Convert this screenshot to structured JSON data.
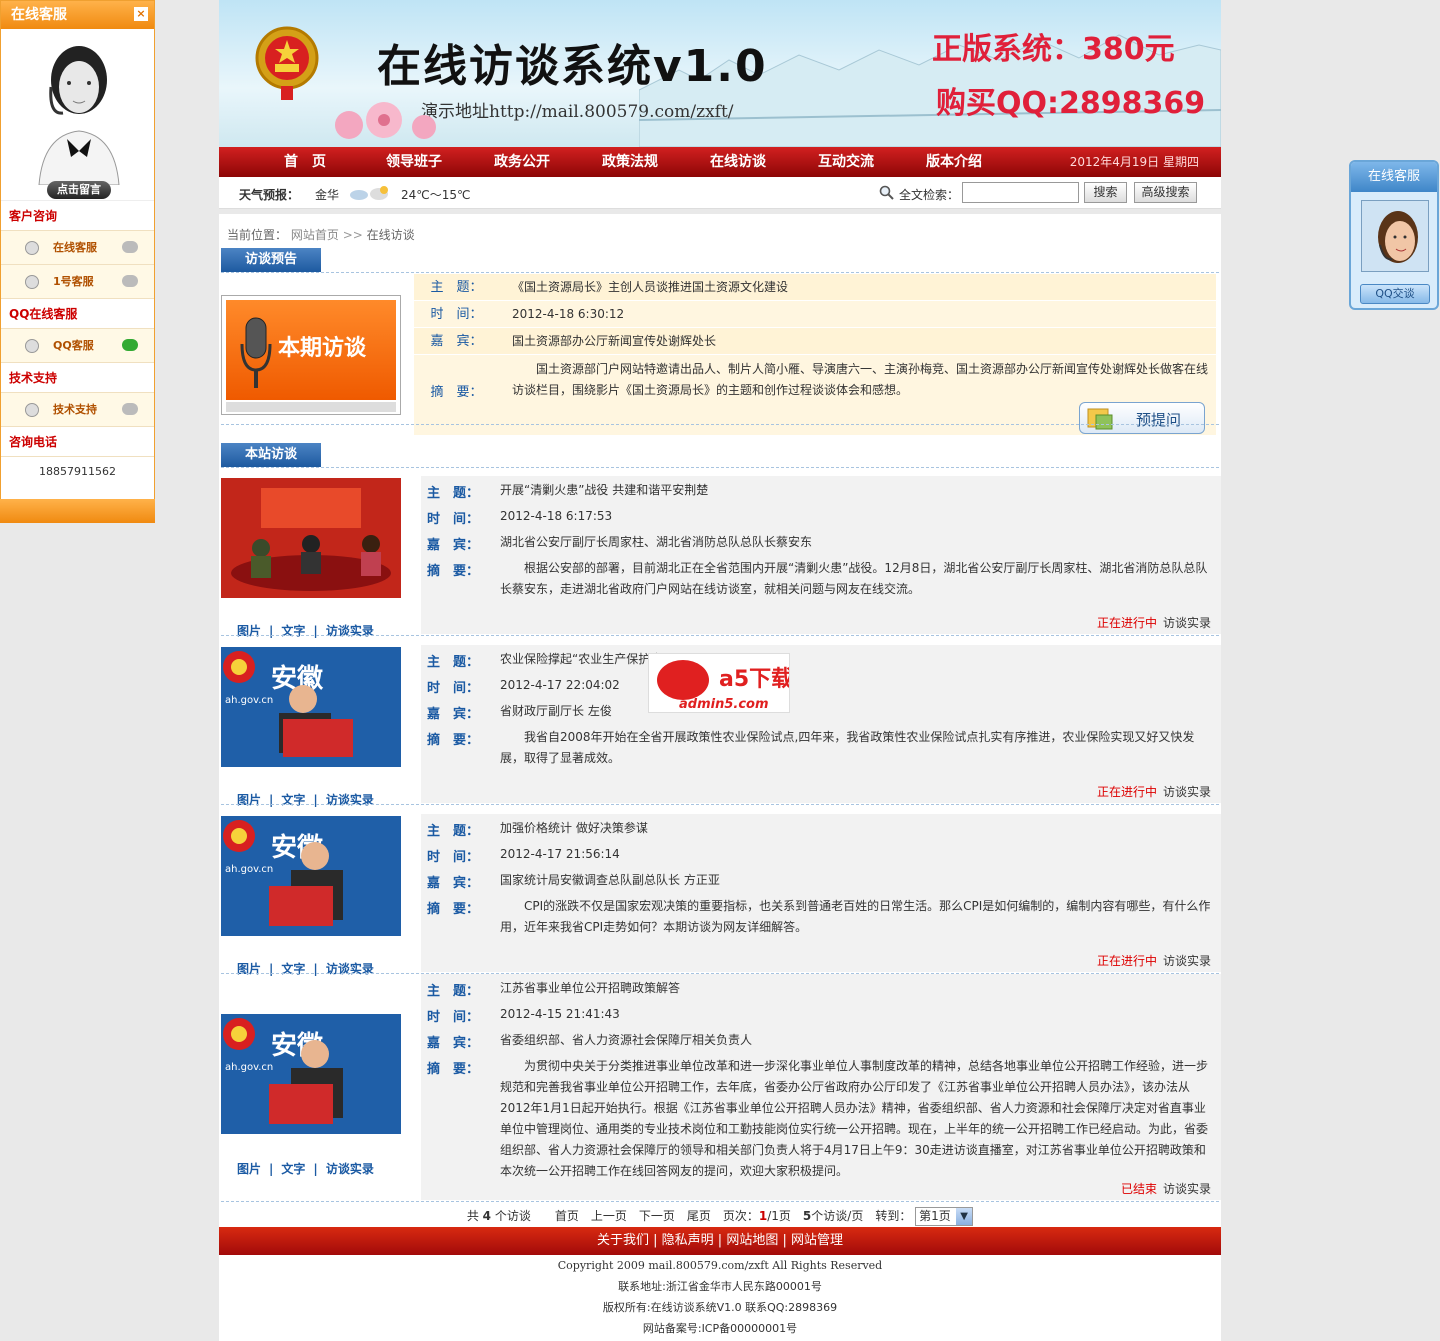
{
  "left_cs": {
    "title": "在线客服",
    "close": "×",
    "leave_msg": "点击留言",
    "sections": [
      {
        "title": "客户咨询",
        "items": [
          "在线客服",
          "1号客服"
        ]
      },
      {
        "title": "QQ在线客服",
        "items": [
          "QQ客服"
        ]
      },
      {
        "title": "技术支持",
        "items": [
          "技术支持"
        ]
      },
      {
        "title": "咨询电话",
        "items": []
      }
    ],
    "phone": "18857911562"
  },
  "right_cs": {
    "title": "在线客服",
    "button": "QQ交谈"
  },
  "banner": {
    "title": "在线访谈系统v1.0",
    "demo": "演示地址http://mail.800579.com/zxft/",
    "price": "正版系统：380元",
    "qq": "购买QQ:2898369"
  },
  "nav": {
    "items": [
      "首　页",
      "领导班子",
      "政务公开",
      "政策法规",
      "在线访谈",
      "互动交流",
      "版本介绍"
    ],
    "date": "2012年4月19日 星期四"
  },
  "toolbar": {
    "weather_label": "天气预报：",
    "city": "金华",
    "temp": "24℃～15℃",
    "search_label": "全文检索：",
    "search_btn": "搜索",
    "adv_btn": "高级搜索"
  },
  "crumb": {
    "label": "当前位置：",
    "home": "网站首页",
    "sep": ">>",
    "current": "在线访谈"
  },
  "preview": {
    "tab": "访谈预告",
    "image_text": "本期访谈",
    "labels": {
      "subject": "主　题：",
      "time": "时　间：",
      "guest": "嘉　宾：",
      "summary": "摘　要："
    },
    "subject": "《国土资源局长》主创人员谈推进国土资源文化建设",
    "time": "2012-4-18 6:30:12",
    "guest": "国土资源部办公厅新闻宣传处谢辉处长",
    "summary": "国土资源部门户网站特邀请出品人、制片人简小雁、导演唐六一、主演孙梅竞、国土资源部办公厅新闻宣传处谢辉处长做客在线访谈栏目，围绕影片《国土资源局长》的主题和创作过程谈谈体会和感想。",
    "ask_btn": "预提问"
  },
  "list": {
    "tab": "本站访谈",
    "links": [
      "图片",
      "|",
      "文字",
      "|",
      "访谈实录"
    ],
    "labels": {
      "subject": "主　题：",
      "time": "时　间：",
      "guest": "嘉　宾：",
      "summary": "摘　要："
    },
    "record": "访谈实录",
    "items": [
      {
        "subject": "开展“清剿火患”战役 共建和谐平安荆楚",
        "time": "2012-4-18 6:17:53",
        "guest": "湖北省公安厅副厅长周家柱、湖北省消防总队总队长蔡安东",
        "summary": "根据公安部的部署，目前湖北正在全省范围内开展“清剿火患”战役。12月8日，湖北省公安厅副厅长周家柱、湖北省消防总队总队长蔡安东，走进湖北省政府门户网站在线访谈室，就相关问题与网友在线交流。",
        "status": "正在进行中"
      },
      {
        "subject": "农业保险撑起“农业生产保护伞”",
        "time": "2012-4-17 22:04:02",
        "guest": "省财政厅副厅长 左俊",
        "summary": "我省自2008年开始在全省开展政策性农业保险试点,四年来，我省政策性农业保险试点扎实有序推进，农业保险实现又好又快发展，取得了显著成效。",
        "status": "正在进行中"
      },
      {
        "subject": "加强价格统计 做好决策参谋",
        "time": "2012-4-17 21:56:14",
        "guest": "国家统计局安徽调查总队副总队长 方正亚",
        "summary": "CPI的涨跌不仅是国家宏观决策的重要指标，也关系到普通老百姓的日常生活。那么CPI是如何编制的，编制内容有哪些，有什么作用，近年来我省CPI走势如何？本期访谈为网友详细解答。",
        "status": "正在进行中"
      },
      {
        "subject": "江苏省事业单位公开招聘政策解答",
        "time": "2012-4-15 21:41:43",
        "guest": "省委组织部、省人力资源社会保障厅相关负责人",
        "summary": "为贯彻中央关于分类推进事业单位改革和进一步深化事业单位人事制度改革的精神，总结各地事业单位公开招聘工作经验，进一步规范和完善我省事业单位公开招聘工作，去年底，省委办公厅省政府办公厅印发了《江苏省事业单位公开招聘人员办法》，该办法从2012年1月1日起开始执行。根据《江苏省事业单位公开招聘人员办法》精神，省委组织部、省人力资源和社会保障厅决定对省直事业单位中管理岗位、通用类的专业技术岗位和工勤技能岗位实行统一公开招聘。现在，上半年的统一公开招聘工作已经启动。为此，省委组织部、省人力资源社会保障厅的领导和相关部门负责人将于4月17日上午9：30走进访谈直播室，对江苏省事业单位公开招聘政策和本次统一公开招聘工作在线回答网友的提问，欢迎大家积极提问。",
        "status": "已结束"
      }
    ]
  },
  "watermark": {
    "brand": "a5下载",
    "site": "admin5.com"
  },
  "thumb_text": {
    "ah_site": "ah.gov.cn",
    "anhui": "安徽"
  },
  "pager": {
    "text1": "共",
    "total": "4",
    "text2": "个访谈　　首页　上一页　下一页　尾页　页次：",
    "page": "1",
    "text3": "/1页　",
    "per": "5",
    "text4": "个访谈/页　转到：",
    "select": "第1页"
  },
  "footer": {
    "links": [
      "关于我们",
      "隐私声明",
      "网站地图",
      "网站管理"
    ],
    "sep": "|",
    "copyright": "Copyright 2009 mail.800579.com/zxft All Rights Reserved",
    "address": "联系地址:浙江省金华市人民东路00001号",
    "owner": "版权所有:在线访谈系统V1.0 联系QQ:2898369",
    "icp": "网站备案号:ICP备00000001号"
  },
  "colors": {
    "nav_red": "#b01010",
    "label_blue": "#1b5aa3",
    "status_red": "#dd0000",
    "tab_blue": "#2a66ad",
    "orange": "#f08a10"
  }
}
